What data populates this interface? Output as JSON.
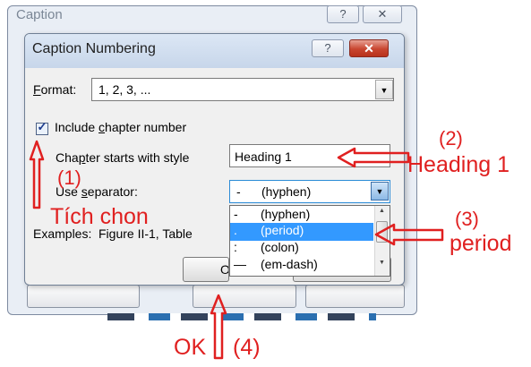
{
  "background_dialog": {
    "title": "Caption",
    "help_glyph": "?",
    "close_glyph": "✕"
  },
  "dialog": {
    "title": "Caption Numbering",
    "help_glyph": "?",
    "close_glyph": "✕"
  },
  "format": {
    "label_prefix": "",
    "label_underlined": "F",
    "label_rest": "ormat:",
    "value": "1, 2, 3, ...",
    "dropdown_glyph": "▼"
  },
  "chapter": {
    "include_checked": true,
    "check_glyph": "✓",
    "include_label_a": "Include ",
    "include_label_u": "c",
    "include_label_b": "hapter number",
    "style_label_a": "Cha",
    "style_label_u": "p",
    "style_label_b": "ter starts with style",
    "style_value": "Heading 1"
  },
  "separator": {
    "label_a": "Use ",
    "label_u": "s",
    "label_b": "eparator:",
    "selected_char": "-",
    "selected_text": "(hyphen)",
    "dropdown_glyph": "▼",
    "options": [
      {
        "char": "-",
        "text": "(hyphen)",
        "selected": false
      },
      {
        "char": ".",
        "text": "(period)",
        "selected": true
      },
      {
        "char": ":",
        "text": "(colon)",
        "selected": false
      },
      {
        "char": "—",
        "text": "(em-dash)",
        "selected": false
      }
    ],
    "scroll_up_glyph": "▲",
    "scroll_down_glyph": "▼"
  },
  "examples": {
    "label": "Examples:",
    "value": "Figure II-1, Table"
  },
  "buttons": {
    "ok": "O"
  },
  "annotations": {
    "step1_number": "(1)",
    "step1_text": "Tích chon",
    "step2_number": "(2)",
    "step2_text": "Heading 1",
    "step3_number": "(3)",
    "step3_text": "period",
    "ok_text": "OK",
    "step4_number": "(4)",
    "color": "#e02020"
  }
}
